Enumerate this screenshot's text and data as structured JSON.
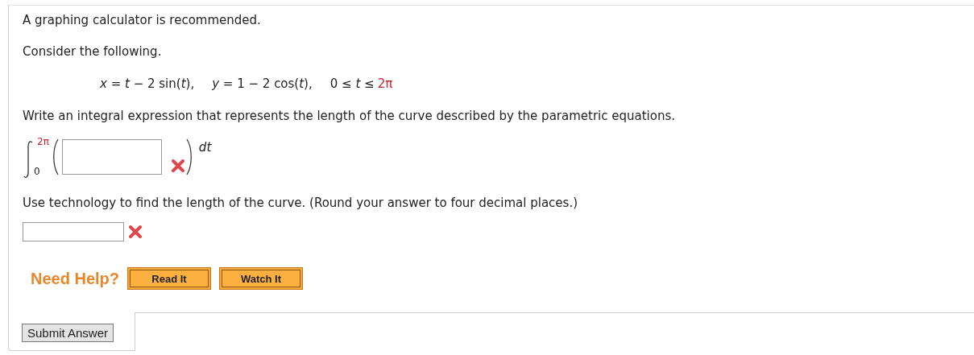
{
  "notice": "A graphing calculator is recommended.",
  "intro": "Consider the following.",
  "equations": [
    {
      "text": "*x* = *t* − 2 sin(*t*),"
    },
    {
      "text": "*y* = 1 − 2 cos(*t*),"
    },
    {
      "text": "0 ≤ *t* ≤",
      "bound": "2π"
    }
  ],
  "prompt_1": "Write an integral expression that represents the length of the curve described by the parametric equations.",
  "integral": {
    "upper": "2π",
    "lower": "0",
    "differential": "dt",
    "answer": {
      "correct": false
    }
  },
  "prompt_2": "Use technology to find the length of the curve. (Round your answer to four decimal places.)",
  "length_answer": {
    "correct": false
  },
  "help": {
    "label": "Need Help?",
    "buttons": [
      "Read It",
      "Watch It"
    ]
  },
  "submit": "Submit Answer"
}
